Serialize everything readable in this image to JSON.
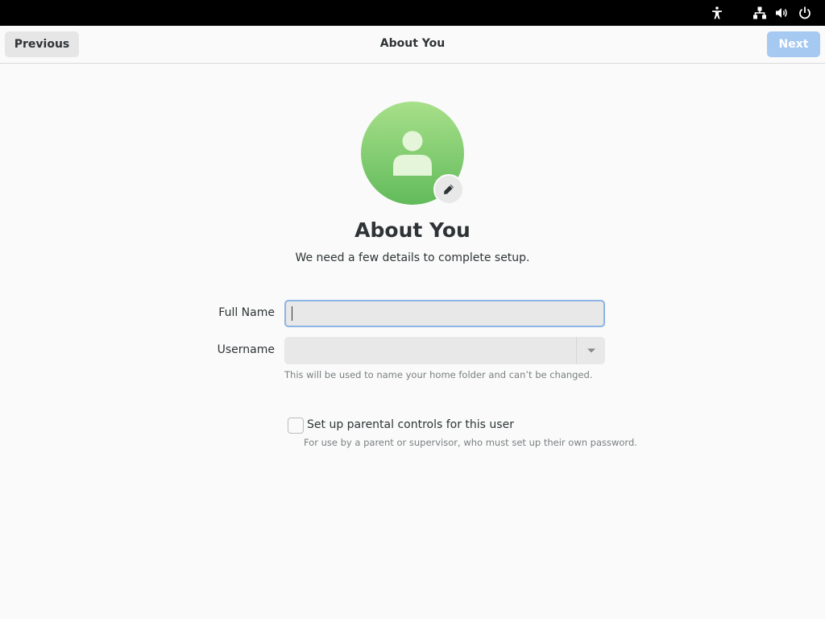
{
  "topbar": {
    "icons": [
      "accessibility-icon",
      "network-icon",
      "volume-icon",
      "power-icon"
    ]
  },
  "header": {
    "previous_label": "Previous",
    "title": "About You",
    "next_label": "Next"
  },
  "page": {
    "title": "About You",
    "subtitle": "We need a few details to complete setup."
  },
  "form": {
    "full_name_label": "Full Name",
    "full_name_value": "",
    "username_label": "Username",
    "username_value": "",
    "username_hint": "This will be used to name your home folder and can’t be changed."
  },
  "parental": {
    "label": "Set up parental controls for this user",
    "hint": "For use by a parent or supervisor, who must set up their own password.",
    "checked": false
  },
  "colors": {
    "accent_disabled": "#a6c9f2",
    "avatar_top": "#a8e08a",
    "avatar_bottom": "#62bb5b",
    "focus_border": "#8cb4e4"
  }
}
